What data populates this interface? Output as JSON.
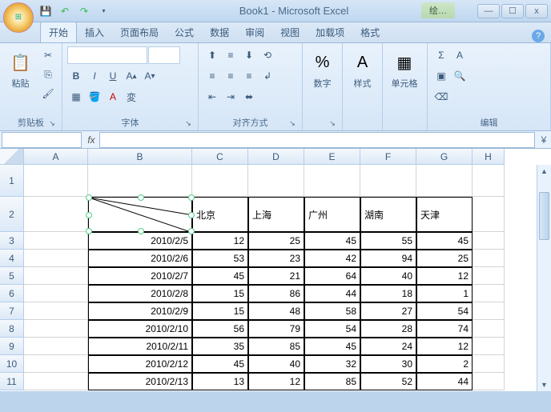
{
  "title": "Book1 - Microsoft Excel",
  "context_tab": "绘…",
  "qat": {
    "save": "💾",
    "undo": "↶",
    "redo": "↷"
  },
  "win": {
    "min": "—",
    "max": "☐",
    "close": "x"
  },
  "tabs": [
    "开始",
    "插入",
    "页面布局",
    "公式",
    "数据",
    "审阅",
    "视图",
    "加载项",
    "格式"
  ],
  "help": "?",
  "groups": {
    "clipboard": {
      "label": "剪贴板",
      "paste": "粘贴"
    },
    "font": {
      "label": "字体"
    },
    "align": {
      "label": "对齐方式"
    },
    "number": {
      "label": "数字",
      "btn": "%"
    },
    "styles": {
      "label": "样式"
    },
    "cells": {
      "label": "单元格"
    },
    "editing": {
      "label": "编辑"
    }
  },
  "namebox": "",
  "fx": "fx",
  "cols": [
    "A",
    "B",
    "C",
    "D",
    "E",
    "F",
    "G",
    "H"
  ],
  "rows": [
    "1",
    "2",
    "3",
    "4",
    "5",
    "6",
    "7",
    "8",
    "9",
    "10",
    "11"
  ],
  "headers": [
    "北京",
    "上海",
    "广州",
    "湖南",
    "天津"
  ],
  "data": [
    {
      "d": "2010/2/5",
      "v": [
        12,
        25,
        45,
        55,
        45
      ]
    },
    {
      "d": "2010/2/6",
      "v": [
        53,
        23,
        42,
        94,
        25
      ]
    },
    {
      "d": "2010/2/7",
      "v": [
        45,
        21,
        64,
        40,
        12
      ]
    },
    {
      "d": "2010/2/8",
      "v": [
        15,
        86,
        44,
        18,
        1
      ]
    },
    {
      "d": "2010/2/9",
      "v": [
        15,
        48,
        58,
        27,
        54
      ]
    },
    {
      "d": "2010/2/10",
      "v": [
        56,
        79,
        54,
        28,
        74
      ]
    },
    {
      "d": "2010/2/11",
      "v": [
        35,
        85,
        45,
        24,
        12
      ]
    },
    {
      "d": "2010/2/12",
      "v": [
        45,
        40,
        32,
        30,
        2
      ]
    },
    {
      "d": "2010/2/13",
      "v": [
        13,
        12,
        85,
        52,
        44
      ]
    }
  ]
}
